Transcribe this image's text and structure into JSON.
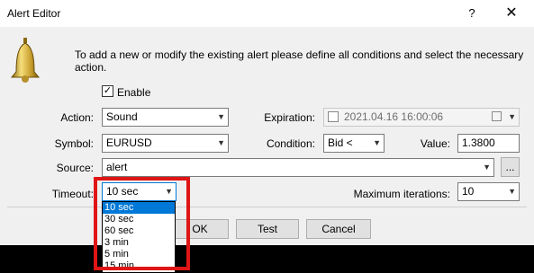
{
  "window": {
    "title": "Alert Editor",
    "help_glyph": "?",
    "close_glyph": "✕"
  },
  "description": "To add a new or modify the existing alert please define all conditions and select the necessary action.",
  "enable": {
    "label": "Enable",
    "checked": true
  },
  "action": {
    "label": "Action:",
    "value": "Sound"
  },
  "expiration": {
    "label": "Expiration:",
    "value": "2021.04.16 16:00:06",
    "enabled": false
  },
  "symbol": {
    "label": "Symbol:",
    "value": "EURUSD"
  },
  "condition": {
    "label": "Condition:",
    "value": "Bid <"
  },
  "value": {
    "label": "Value:",
    "value": "1.3800"
  },
  "source": {
    "label": "Source:",
    "value": "alert",
    "browse_label": "..."
  },
  "timeout": {
    "label": "Timeout:",
    "value": "10 sec",
    "options": [
      "10 sec",
      "30 sec",
      "60 sec",
      "3 min",
      "5 min",
      "15 min"
    ],
    "selected_index": 0
  },
  "max_iterations": {
    "label": "Maximum iterations:",
    "value": "10"
  },
  "buttons": {
    "ok": "OK",
    "test": "Test",
    "cancel": "Cancel"
  },
  "colors": {
    "highlight": "#e01515",
    "selection": "#0078d7"
  },
  "icons": {
    "bell": "bell-icon",
    "dropdown": "chevron-down-icon",
    "calendar": "calendar-icon"
  }
}
